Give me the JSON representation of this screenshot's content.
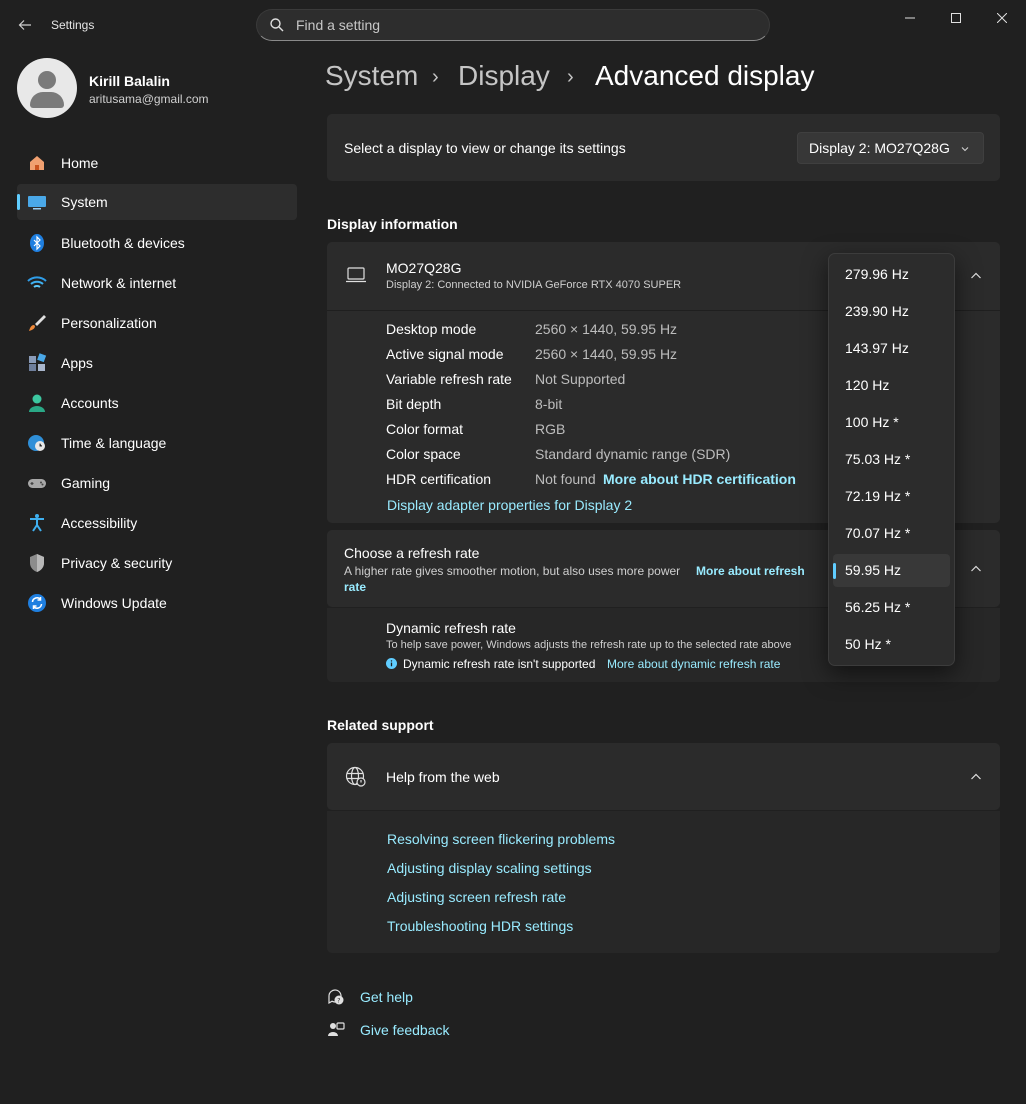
{
  "app": {
    "title": "Settings"
  },
  "search": {
    "placeholder": "Find a setting"
  },
  "user": {
    "name": "Kirill Balalin",
    "email": "aritusama@gmail.com"
  },
  "nav": {
    "items": [
      {
        "label": "Home",
        "icon": "home-icon"
      },
      {
        "label": "System",
        "icon": "system-icon",
        "active": true
      },
      {
        "label": "Bluetooth & devices",
        "icon": "bluetooth-icon"
      },
      {
        "label": "Network & internet",
        "icon": "wifi-icon"
      },
      {
        "label": "Personalization",
        "icon": "brush-icon"
      },
      {
        "label": "Apps",
        "icon": "apps-icon"
      },
      {
        "label": "Accounts",
        "icon": "account-icon"
      },
      {
        "label": "Time & language",
        "icon": "globe-clock-icon"
      },
      {
        "label": "Gaming",
        "icon": "gamepad-icon"
      },
      {
        "label": "Accessibility",
        "icon": "accessibility-icon"
      },
      {
        "label": "Privacy & security",
        "icon": "shield-icon"
      },
      {
        "label": "Windows Update",
        "icon": "update-icon"
      }
    ]
  },
  "breadcrumb": {
    "level1": "System",
    "level2": "Display",
    "current": "Advanced display"
  },
  "display_select": {
    "label": "Select a display to view or change its settings",
    "value": "Display 2: MO27Q28G"
  },
  "display_info": {
    "section_title": "Display information",
    "monitor_name": "MO27Q28G",
    "monitor_subtitle": "Display 2: Connected to NVIDIA GeForce RTX 4070 SUPER",
    "rows": [
      {
        "label": "Desktop mode",
        "value": "2560 × 1440, 59.95 Hz"
      },
      {
        "label": "Active signal mode",
        "value": "2560 × 1440, 59.95 Hz"
      },
      {
        "label": "Variable refresh rate",
        "value": "Not Supported"
      },
      {
        "label": "Bit depth",
        "value": "8-bit"
      },
      {
        "label": "Color format",
        "value": "RGB"
      },
      {
        "label": "Color space",
        "value": "Standard dynamic range (SDR)"
      },
      {
        "label": "HDR certification",
        "value": "Not found",
        "link": "More about HDR certification"
      }
    ],
    "adapter_link": "Display adapter properties for Display 2"
  },
  "refresh": {
    "title": "Choose a refresh rate",
    "desc": "A higher rate gives smoother motion, but also uses more power",
    "more_link_1": "More about refresh",
    "more_link_2": "rate",
    "dynamic_title": "Dynamic refresh rate",
    "dynamic_desc": "To help save power, Windows adjusts the refresh rate up to the selected rate above",
    "dynamic_warning": "Dynamic refresh rate isn't supported",
    "dynamic_link": "More about dynamic refresh rate",
    "options": [
      "279.96 Hz",
      "239.90 Hz",
      "143.97 Hz",
      "120 Hz",
      "100 Hz *",
      "75.03 Hz *",
      "72.19 Hz *",
      "70.07 Hz *",
      "59.95 Hz",
      "56.25 Hz *",
      "50 Hz *"
    ],
    "selected": "59.95 Hz"
  },
  "related": {
    "section_title": "Related support",
    "help_title": "Help from the web",
    "links": [
      "Resolving screen flickering problems",
      "Adjusting display scaling settings",
      "Adjusting screen refresh rate",
      "Troubleshooting HDR settings"
    ]
  },
  "footer": {
    "get_help": "Get help",
    "give_feedback": "Give feedback"
  },
  "colors": {
    "accent": "#60cdff",
    "link": "#99ebff",
    "background": "#202020",
    "card": "#2b2b2b"
  }
}
